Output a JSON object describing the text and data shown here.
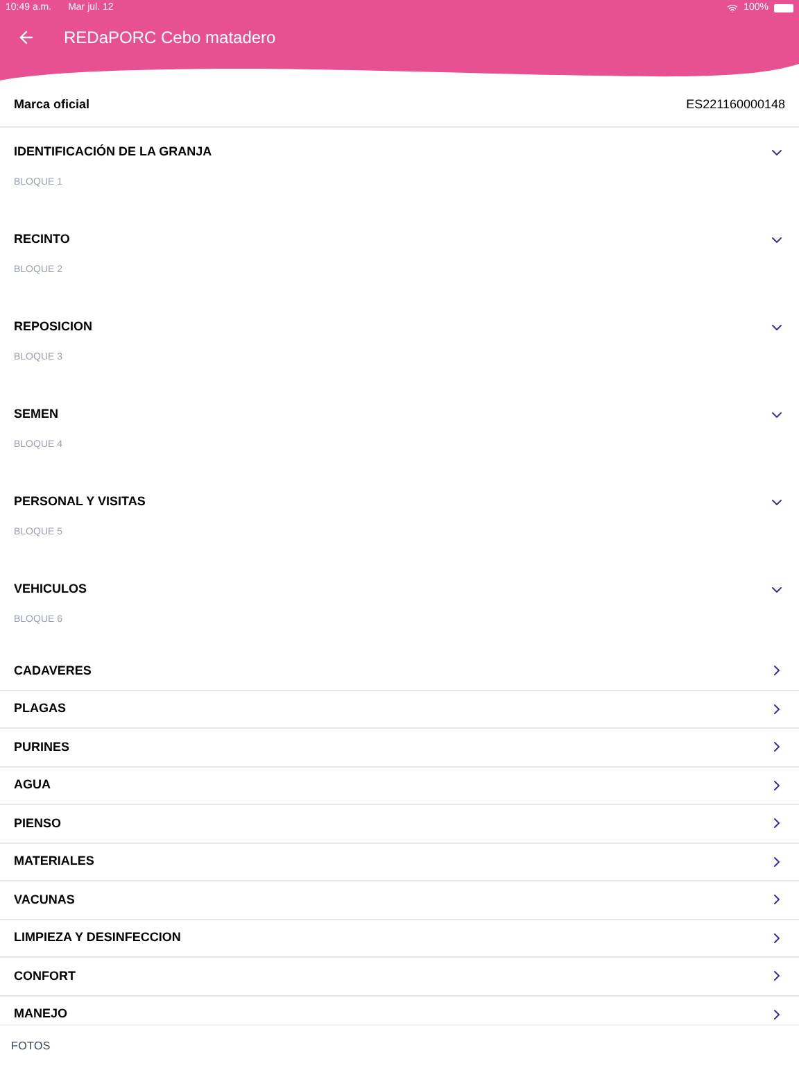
{
  "status_bar": {
    "time": "10:49 a.m.",
    "date": "Mar jul. 12",
    "battery": "100%"
  },
  "header": {
    "title": "REDaPORC Cebo matadero"
  },
  "official_mark": {
    "label": "Marca oficial",
    "value": "ES221160000148"
  },
  "items": [
    {
      "kind": "section",
      "label": "IDENTIFICACIÓN DE LA GRANJA",
      "caption": "BLOQUE 1"
    },
    {
      "kind": "section",
      "label": "RECINTO",
      "caption": "BLOQUE 2"
    },
    {
      "kind": "section",
      "label": "REPOSICION",
      "caption": "BLOQUE 3"
    },
    {
      "kind": "section",
      "label": "SEMEN",
      "caption": "BLOQUE 4"
    },
    {
      "kind": "section",
      "label": "PERSONAL Y VISITAS",
      "caption": "BLOQUE 5"
    },
    {
      "kind": "section",
      "label": "VEHICULOS",
      "caption": "BLOQUE 6"
    },
    {
      "kind": "link",
      "label": "CADAVERES"
    },
    {
      "kind": "link",
      "label": "PLAGAS"
    },
    {
      "kind": "link",
      "label": "PURINES"
    },
    {
      "kind": "link",
      "label": "AGUA"
    },
    {
      "kind": "link",
      "label": "PIENSO"
    },
    {
      "kind": "link",
      "label": "MATERIALES"
    },
    {
      "kind": "link",
      "label": "VACUNAS"
    },
    {
      "kind": "link",
      "label": "LIMPIEZA Y DESINFECCION"
    },
    {
      "kind": "link",
      "label": "CONFORT"
    },
    {
      "kind": "link",
      "label": "MANEJO"
    }
  ],
  "footer": {
    "label": "FOTOS"
  }
}
